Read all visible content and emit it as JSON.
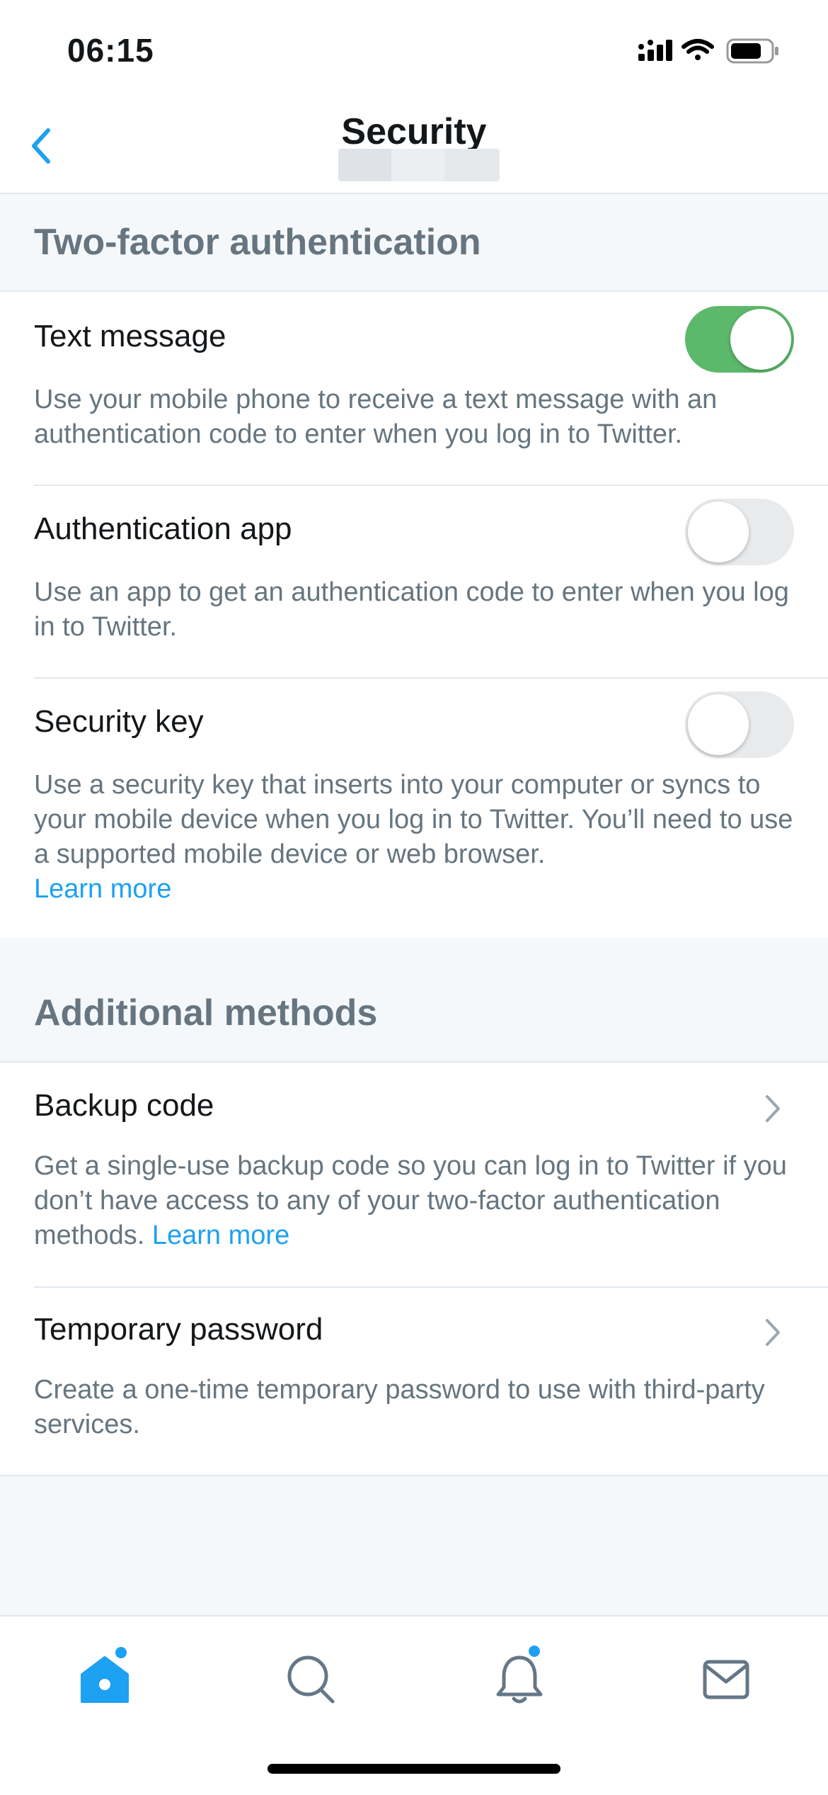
{
  "status": {
    "time": "06:15",
    "icons": [
      "cellular-icon",
      "wifi-icon",
      "battery-icon"
    ]
  },
  "nav": {
    "title": "Security",
    "back_icon": "chevron-left-icon"
  },
  "sections": {
    "two_factor": {
      "heading": "Two-factor authentication",
      "items": [
        {
          "title": "Text message",
          "description": "Use your mobile phone to receive a text message with an authentication code to enter when you log in to Twitter.",
          "enabled": true
        },
        {
          "title": "Authentication app",
          "description": "Use an app to get an authentication code to enter when you log in to Twitter.",
          "enabled": false
        },
        {
          "title": "Security key",
          "description": "Use a security key that inserts into your computer or syncs to your mobile device when you log in to Twitter. You’ll need to use a supported mobile device or web browser.",
          "link": "Learn more",
          "enabled": false
        }
      ]
    },
    "additional": {
      "heading": "Additional methods",
      "items": [
        {
          "title": "Backup code",
          "description": "Get a single-use backup code so you can log in to Twitter if you don’t have access to any of your two-factor authentication methods.",
          "link": "Learn more"
        },
        {
          "title": "Temporary password",
          "description": "Create a one-time temporary password to use with third-party services."
        }
      ]
    }
  },
  "tabs": [
    {
      "name": "home-icon",
      "badge": true
    },
    {
      "name": "search-icon",
      "badge": false
    },
    {
      "name": "notifications-bell-icon",
      "badge": true
    },
    {
      "name": "messages-envelope-icon",
      "badge": false
    }
  ],
  "colors": {
    "accent": "#1da1f2",
    "toggle_on": "#5cb86a",
    "text_secondary": "#66757f"
  }
}
